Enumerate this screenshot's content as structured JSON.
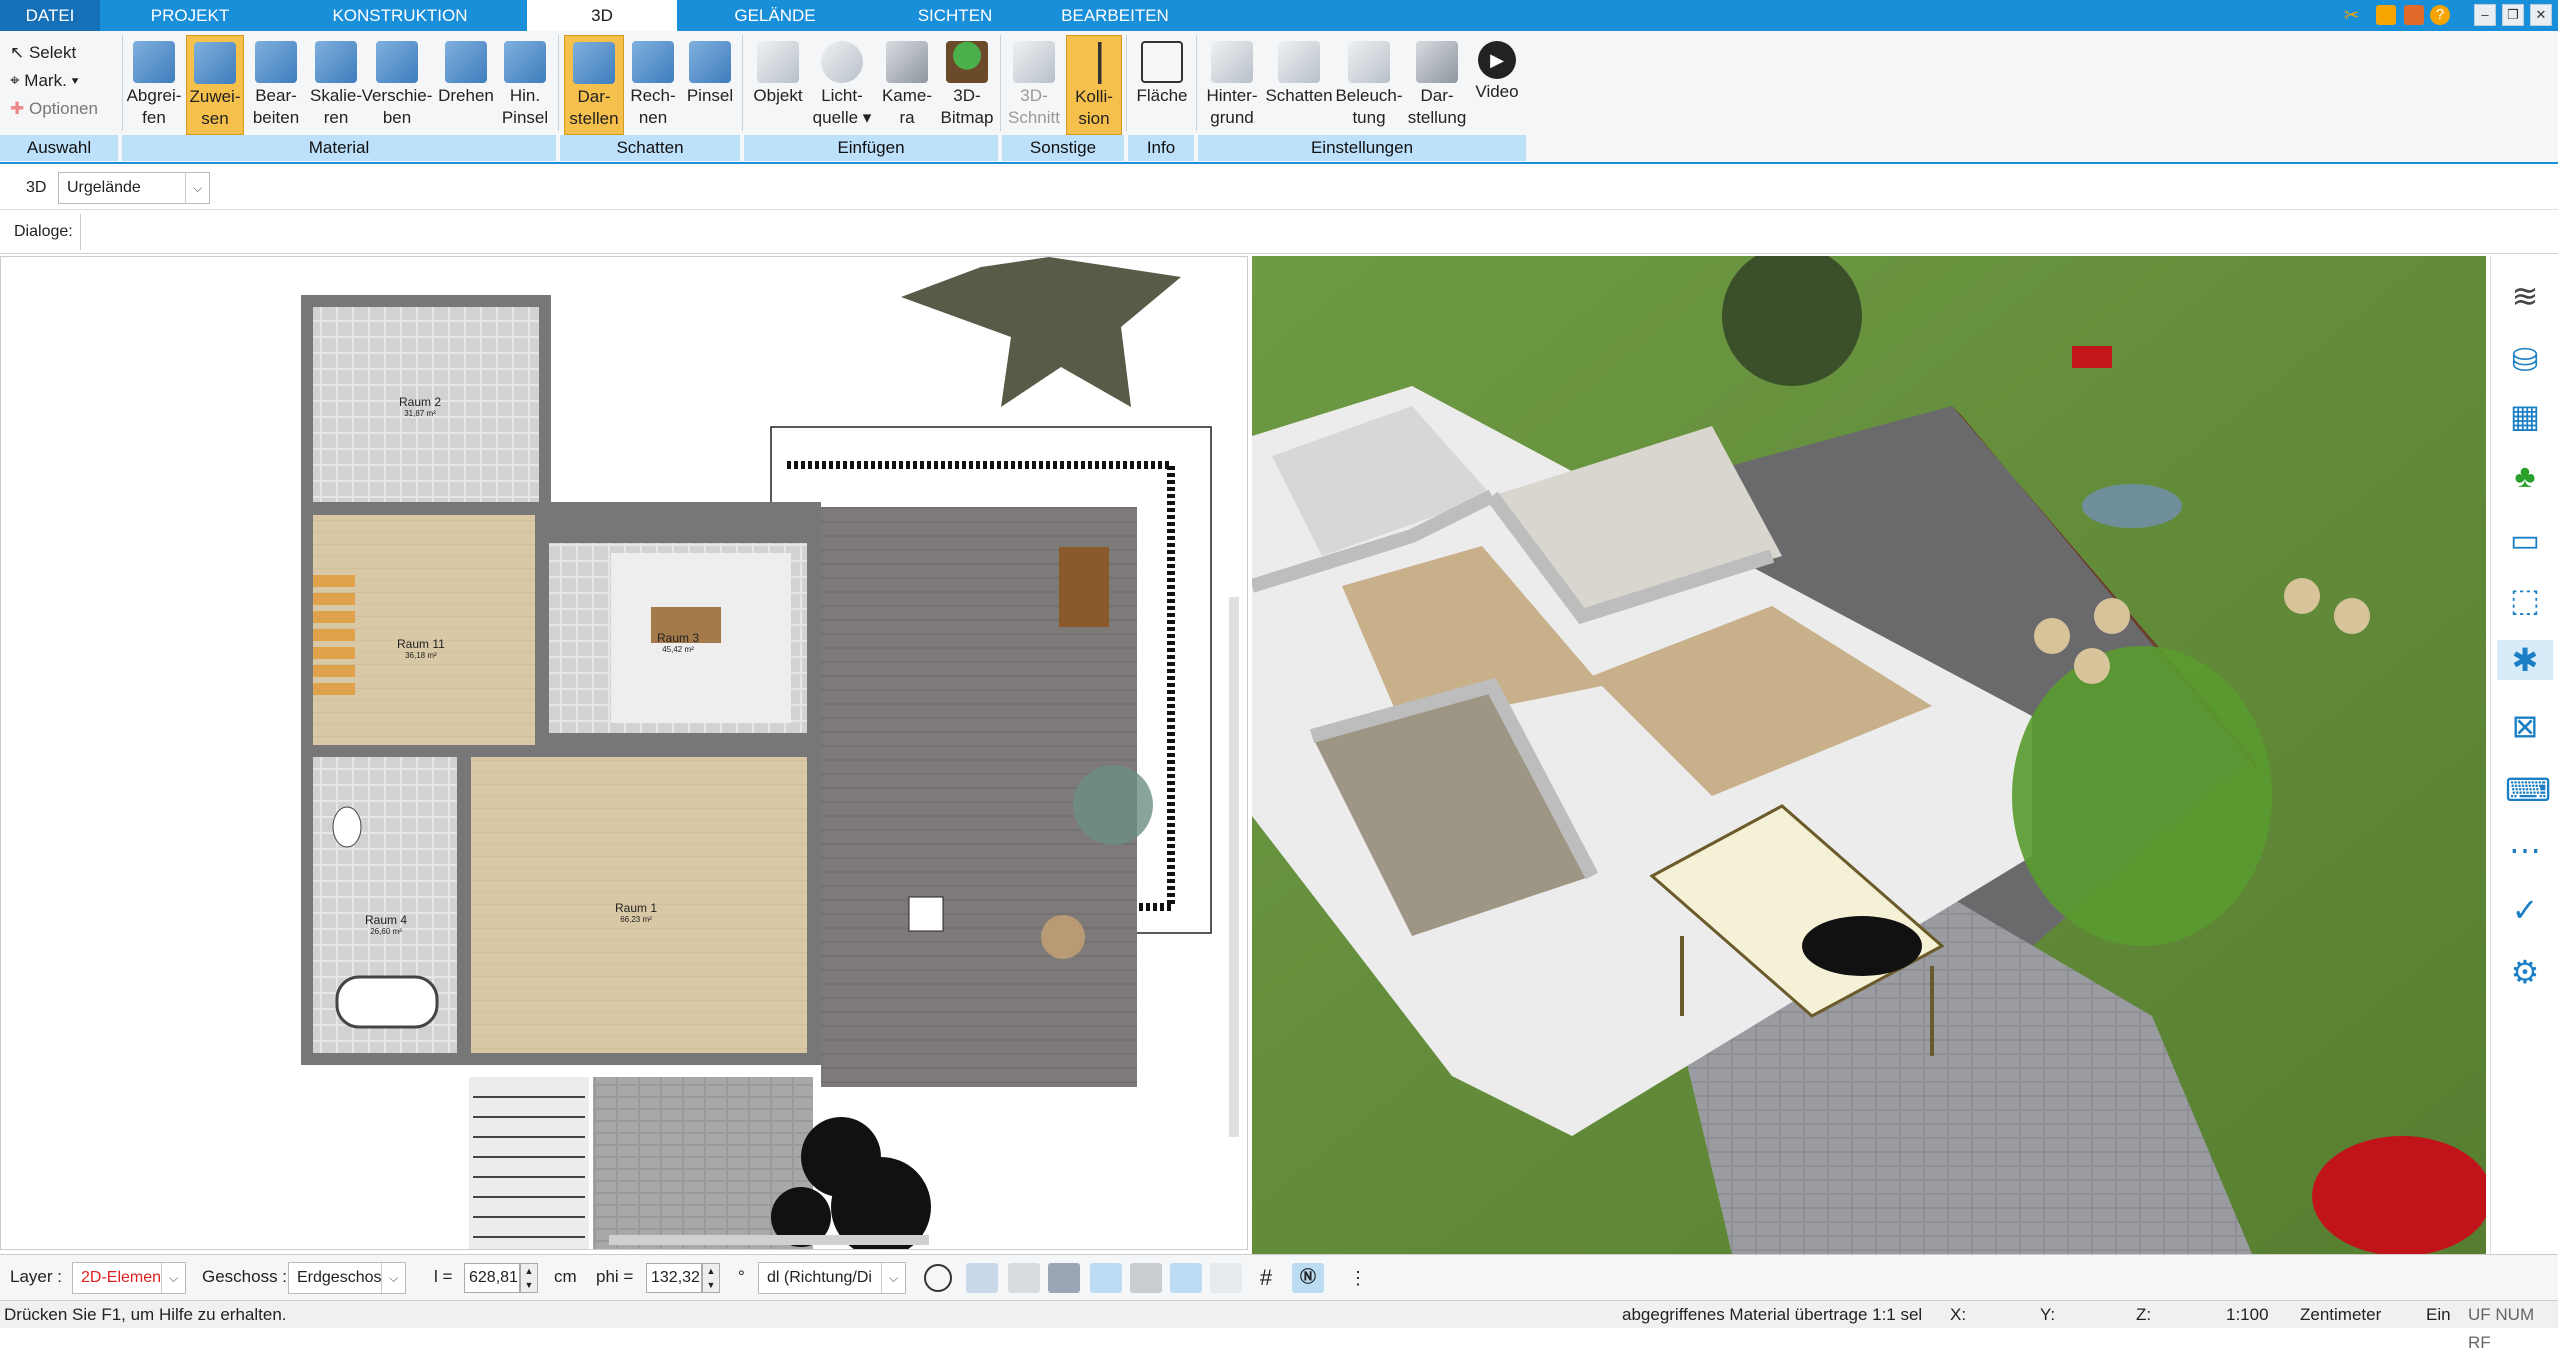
{
  "tabs": [
    {
      "label": "DATEI"
    },
    {
      "label": "PROJEKT"
    },
    {
      "label": "KONSTRUKTION"
    },
    {
      "label": "3D"
    },
    {
      "label": "GELÄNDE"
    },
    {
      "label": "SICHTEN"
    },
    {
      "label": "BEARBEITEN"
    }
  ],
  "ribbon": {
    "auswahl": {
      "select": "Selekt",
      "mark": "Mark.",
      "options": "Optionen",
      "group": "Auswahl"
    },
    "material": {
      "group": "Material",
      "buttons": [
        {
          "l1": "Abgrei-",
          "l2": "fen"
        },
        {
          "l1": "Zuwei-",
          "l2": "sen"
        },
        {
          "l1": "Bear-",
          "l2": "beiten"
        },
        {
          "l1": "Skalie-",
          "l2": "ren"
        },
        {
          "l1": "Verschie-",
          "l2": "ben"
        },
        {
          "l1": "Drehen",
          "l2": ""
        },
        {
          "l1": "Hin.",
          "l2": "Pinsel"
        }
      ]
    },
    "schatten": {
      "group": "Schatten",
      "buttons": [
        {
          "l1": "Dar-",
          "l2": "stellen"
        },
        {
          "l1": "Rech-",
          "l2": "nen"
        },
        {
          "l1": "Pinsel",
          "l2": ""
        }
      ]
    },
    "einfuegen": {
      "group": "Einfügen",
      "buttons": [
        {
          "l1": "Objekt",
          "l2": ""
        },
        {
          "l1": "Licht-",
          "l2": "quelle"
        },
        {
          "l1": "Kame-",
          "l2": "ra"
        },
        {
          "l1": "3D-",
          "l2": "Bitmap"
        }
      ]
    },
    "sonstige": {
      "group": "Sonstige",
      "buttons": [
        {
          "l1": "3D-",
          "l2": "Schnitt"
        },
        {
          "l1": "Kolli-",
          "l2": "sion"
        }
      ]
    },
    "info": {
      "group": "Info",
      "buttons": [
        {
          "l1": "Fläche",
          "l2": ""
        }
      ]
    },
    "einstellungen": {
      "group": "Einstellungen",
      "buttons": [
        {
          "l1": "Hinter-",
          "l2": "grund"
        },
        {
          "l1": "Schatten",
          "l2": ""
        },
        {
          "l1": "Beleuch-",
          "l2": "tung"
        },
        {
          "l1": "Dar-",
          "l2": "stellung"
        },
        {
          "l1": "Video",
          "l2": ""
        }
      ]
    }
  },
  "toolbar": {
    "mode": "3D",
    "terrain": "Urgelände",
    "dialogs_label": "Dialoge:"
  },
  "plan": {
    "rooms": [
      {
        "name": "Raum 2",
        "area": "31,87 m²"
      },
      {
        "name": "Raum 11",
        "area": "36,18 m²"
      },
      {
        "name": "Raum 3",
        "area": "45,42 m²"
      },
      {
        "name": "Raum 1",
        "area": "66,23 m²"
      },
      {
        "name": "Raum 4",
        "area": "26,60 m²"
      }
    ]
  },
  "bottom": {
    "layer_label": "Layer :",
    "layer_value": "2D-Elemen",
    "floor_label": "Geschoss :",
    "floor_value": "Erdgeschos",
    "l_label": "l =",
    "l_value": "628,81",
    "l_unit": "cm",
    "phi_label": "phi =",
    "phi_value": "132,32",
    "phi_unit": "°",
    "direction_value": "dl (Richtung/Di"
  },
  "status": {
    "help": "Drücken Sie F1, um Hilfe zu erhalten.",
    "message": "abgegriffenes Material übertrage 1:1 sel",
    "x": "X:",
    "y": "Y:",
    "z": "Z:",
    "scale": "1:100",
    "unit": "Zentimeter",
    "mode": "Ein",
    "flags": "UF NUM RF"
  },
  "colors": {
    "accent": "#1a8fd9",
    "active": "#f6c04c",
    "group_bg": "#bde0fb"
  }
}
